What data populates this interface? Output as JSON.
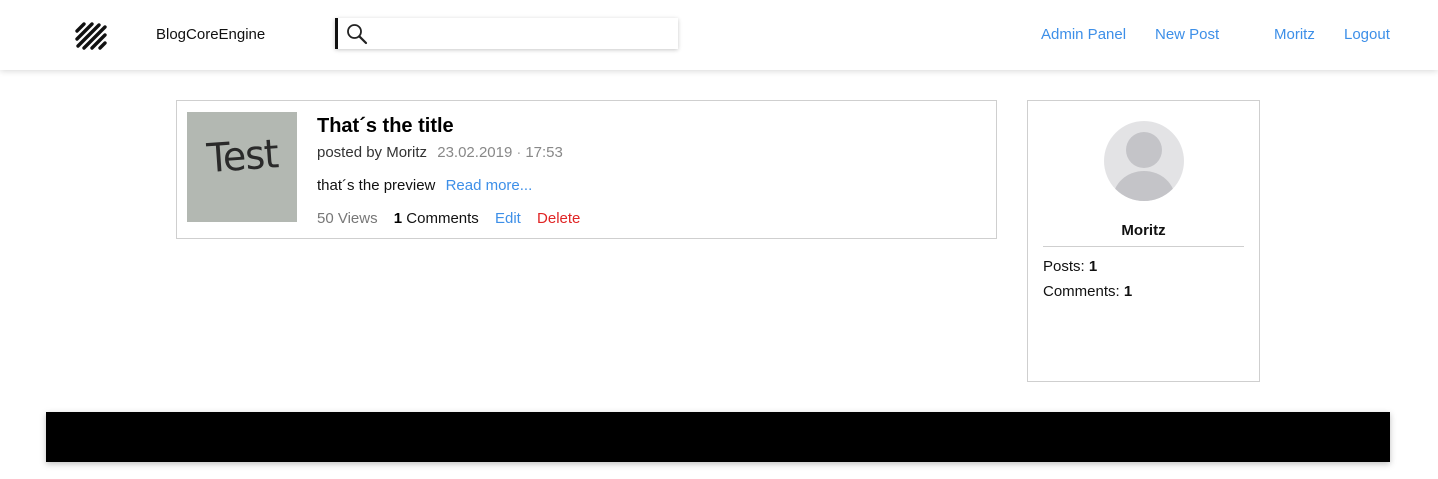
{
  "header": {
    "brand": "BlogCoreEngine",
    "search": {
      "value": "",
      "placeholder": ""
    },
    "nav": {
      "admin_panel": "Admin Panel",
      "new_post": "New Post",
      "user": "Moritz",
      "logout": "Logout"
    }
  },
  "post": {
    "thumbnail_text": "Test",
    "title": "That´s the title",
    "posted_by_label": "posted by",
    "author": "Moritz",
    "date": "23.02.2019",
    "time": "17:53",
    "preview": "that´s the preview",
    "read_more": "Read more...",
    "views": "50 Views",
    "comments_count": "1",
    "comments_label": "Comments",
    "edit": "Edit",
    "delete": "Delete"
  },
  "profile": {
    "name": "Moritz",
    "posts_label": "Posts:",
    "posts_value": "1",
    "comments_label": "Comments:",
    "comments_value": "1"
  },
  "colors": {
    "link": "#3d8fe8",
    "danger": "#e02424",
    "footer": "#000000",
    "border": "#cfcfcf"
  },
  "icons": {
    "logo": "diagonal-stripes-logo-icon",
    "search": "search-icon",
    "avatar": "user-avatar-icon"
  }
}
